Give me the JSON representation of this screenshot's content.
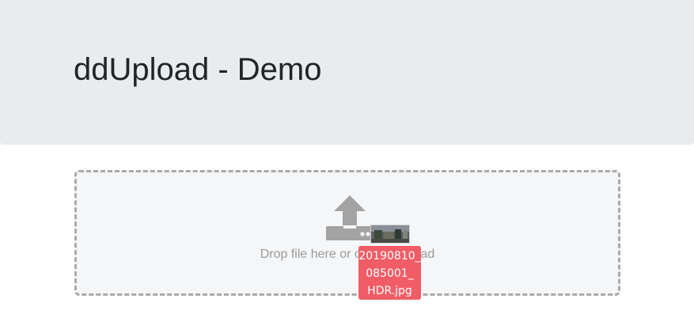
{
  "header": {
    "title": "ddUpload - Demo"
  },
  "dropzone": {
    "text": "Drop file here or click to upload",
    "icon": "upload-icon"
  },
  "drag": {
    "file_name_lines": [
      "20190810_",
      "085001_",
      "HDR.jpg"
    ],
    "thumbnail_icon": "image-thumbnail-icon",
    "badge_color": "#f05d66"
  },
  "colors": {
    "header_bg": "#e9ecef",
    "dropzone_bg": "#f5f6f8",
    "dropzone_border": "#aaaaaa",
    "icon_color": "#9a9a9a"
  }
}
